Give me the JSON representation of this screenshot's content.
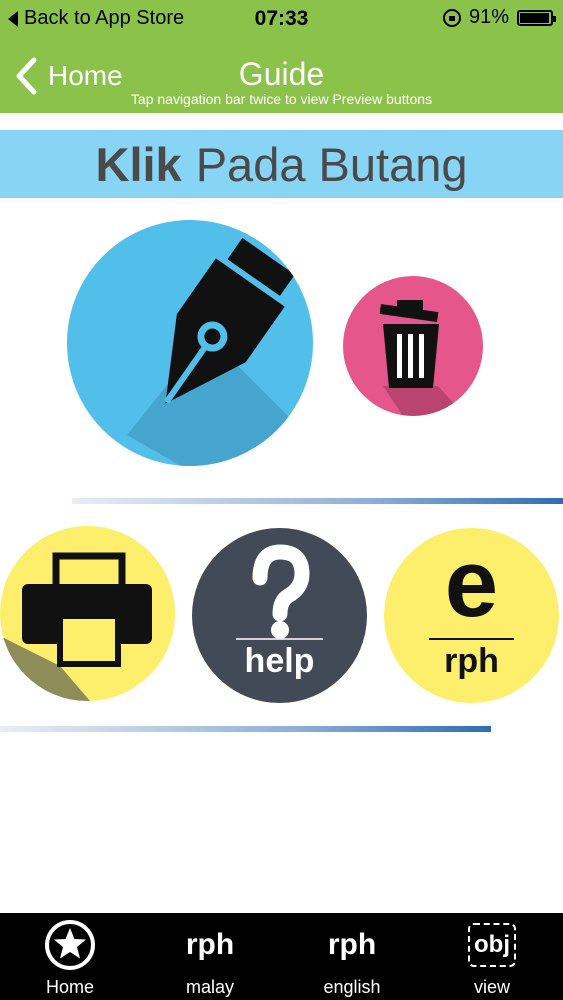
{
  "status_bar": {
    "back_label": "Back to App Store",
    "time": "07:33",
    "battery": "91%"
  },
  "nav": {
    "back_label": "Home",
    "title": "Guide",
    "hint": "Tap navigation bar twice to view Preview buttons"
  },
  "banner": {
    "bold": "Klik",
    "rest": "Pada Butang"
  },
  "buttons": {
    "help_label": "help",
    "erph_letter": "e",
    "erph_label": "rph"
  },
  "tabbar": {
    "items": [
      {
        "icon_text": "",
        "label": "Home"
      },
      {
        "icon_text": "rph",
        "label": "malay"
      },
      {
        "icon_text": "rph",
        "label": "english"
      },
      {
        "icon_text": "obj",
        "label": "view"
      }
    ]
  },
  "colors": {
    "header": "#8bc34a",
    "banner": "#87d4f5",
    "pen_circle": "#52bfeb",
    "trash_circle": "#e5568a",
    "printer_circle": "#fdef6b",
    "help_circle": "#424957",
    "erph_circle": "#fdef6b"
  }
}
